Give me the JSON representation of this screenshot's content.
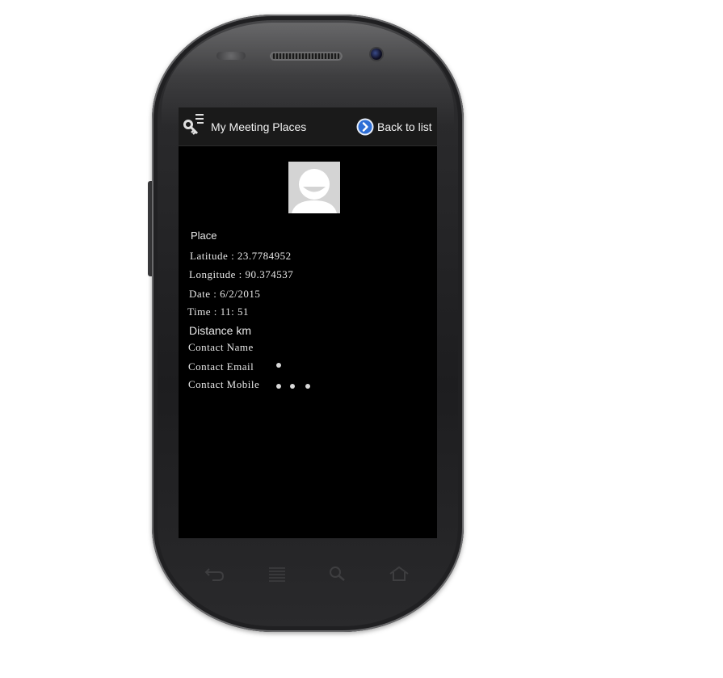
{
  "app": {
    "title": "My Meeting Places",
    "back_label": "Back to list",
    "accent_color": "#2f6fd6"
  },
  "details": {
    "place_label": "Place",
    "latitude": "Latitude : 23.7784952",
    "longitude": "Longitude : 90.374537",
    "date": "Date : 6/2/2015",
    "time": "Time : 11: 51",
    "distance": "Distance km",
    "contact_name": "Contact Name",
    "contact_email": "Contact Email",
    "contact_mobile": "Contact Mobile"
  },
  "icons": {
    "app": "key-list-icon",
    "back": "chevron-right-circle-icon",
    "avatar": "default-user-avatar",
    "nav": [
      "back-arrow-icon",
      "menu-icon",
      "search-icon",
      "home-icon"
    ]
  }
}
